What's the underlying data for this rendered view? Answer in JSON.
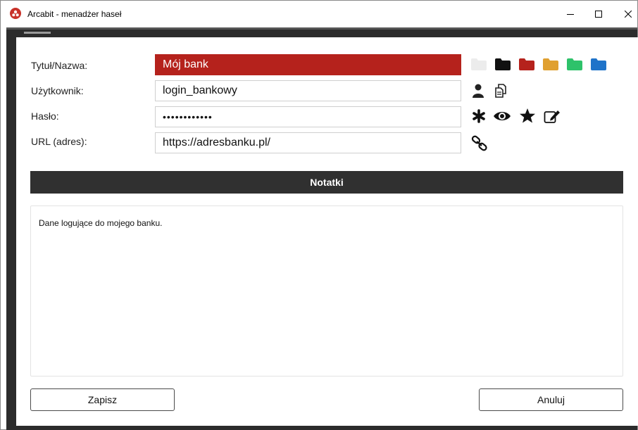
{
  "window": {
    "title": "Arcabit - menadżer haseł"
  },
  "form": {
    "title_label": "Tytuł/Nazwa:",
    "title_value": "Mój bank",
    "user_label": "Użytkownik:",
    "user_value": "login_bankowy",
    "password_label": "Hasło:",
    "password_value": "••••••••••••",
    "url_label": "URL (adres):",
    "url_value": "https://adresbanku.pl/"
  },
  "folder_colors": [
    "#ececec",
    "#111111",
    "#b5221c",
    "#e0a030",
    "#2ec26a",
    "#1f73c9"
  ],
  "icons": {
    "user_row": [
      "user-icon",
      "copy-icon"
    ],
    "password_row": [
      "asterisk-icon",
      "eye-icon",
      "star-icon",
      "edit-icon"
    ],
    "url_row": [
      "link-icon"
    ]
  },
  "notes": {
    "header": "Notatki",
    "text": "Dane logujące do mojego banku."
  },
  "buttons": {
    "save": "Zapisz",
    "cancel": "Anuluj"
  },
  "colors": {
    "accent": "#b5221c",
    "header_bg": "#303030"
  }
}
